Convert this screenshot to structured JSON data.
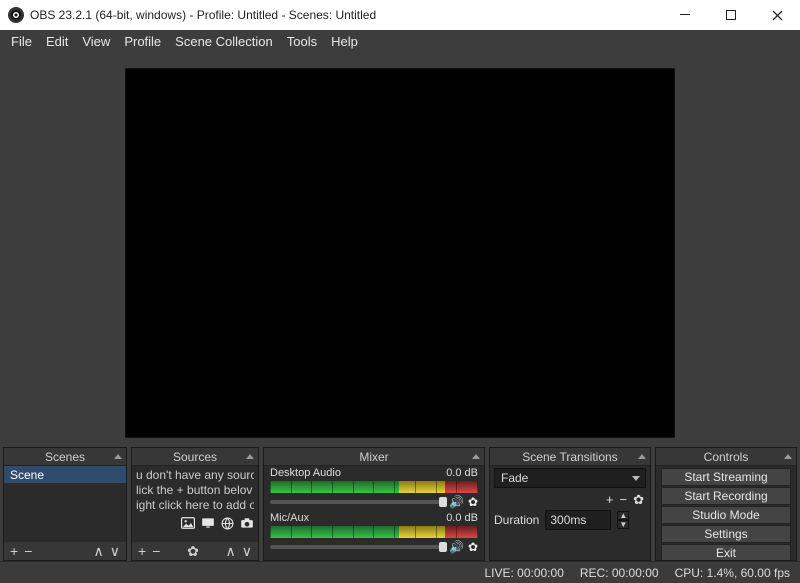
{
  "window": {
    "title": "OBS 23.2.1 (64-bit, windows) - Profile: Untitled - Scenes: Untitled"
  },
  "menubar": [
    "File",
    "Edit",
    "View",
    "Profile",
    "Scene Collection",
    "Tools",
    "Help"
  ],
  "docks": {
    "scenes": {
      "title": "Scenes",
      "items": [
        "Scene"
      ]
    },
    "sources": {
      "title": "Sources",
      "hint_line1": "u don't have any sourc",
      "hint_line2": "lick the + button belov",
      "hint_line3": "ight click here to add o"
    },
    "mixer": {
      "title": "Mixer",
      "channels": [
        {
          "name": "Desktop Audio",
          "db": "0.0 dB"
        },
        {
          "name": "Mic/Aux",
          "db": "0.0 dB"
        }
      ]
    },
    "transitions": {
      "title": "Scene Transitions",
      "selected": "Fade",
      "duration_label": "Duration",
      "duration_value": "300ms"
    },
    "controls": {
      "title": "Controls",
      "buttons": [
        "Start Streaming",
        "Start Recording",
        "Studio Mode",
        "Settings",
        "Exit"
      ]
    }
  },
  "statusbar": {
    "live": "LIVE: 00:00:00",
    "rec": "REC: 00:00:00",
    "cpu": "CPU: 1.4%, 60.00 fps"
  }
}
